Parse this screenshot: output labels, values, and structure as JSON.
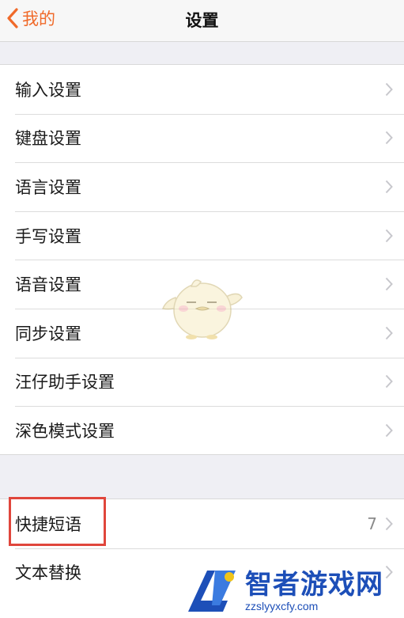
{
  "navbar": {
    "back_label": "我的",
    "title": "设置"
  },
  "group1": {
    "items": [
      {
        "label": "输入设置"
      },
      {
        "label": "键盘设置"
      },
      {
        "label": "语言设置"
      },
      {
        "label": "手写设置"
      },
      {
        "label": "语音设置"
      },
      {
        "label": "同步设置"
      },
      {
        "label": "汪仔助手设置"
      },
      {
        "label": "深色模式设置"
      }
    ]
  },
  "group2": {
    "items": [
      {
        "label": "快捷短语",
        "value": "7"
      },
      {
        "label": "文本替换"
      }
    ]
  },
  "watermark": {
    "title": "智者游戏网",
    "url": "zzslyyxcfy.com"
  },
  "colors": {
    "accent": "#f06a2a",
    "highlight_border": "#e0463c",
    "chevron": "#c7c7cc"
  },
  "icons": {
    "back": "chevron-left-icon",
    "row": "chevron-right-icon"
  }
}
